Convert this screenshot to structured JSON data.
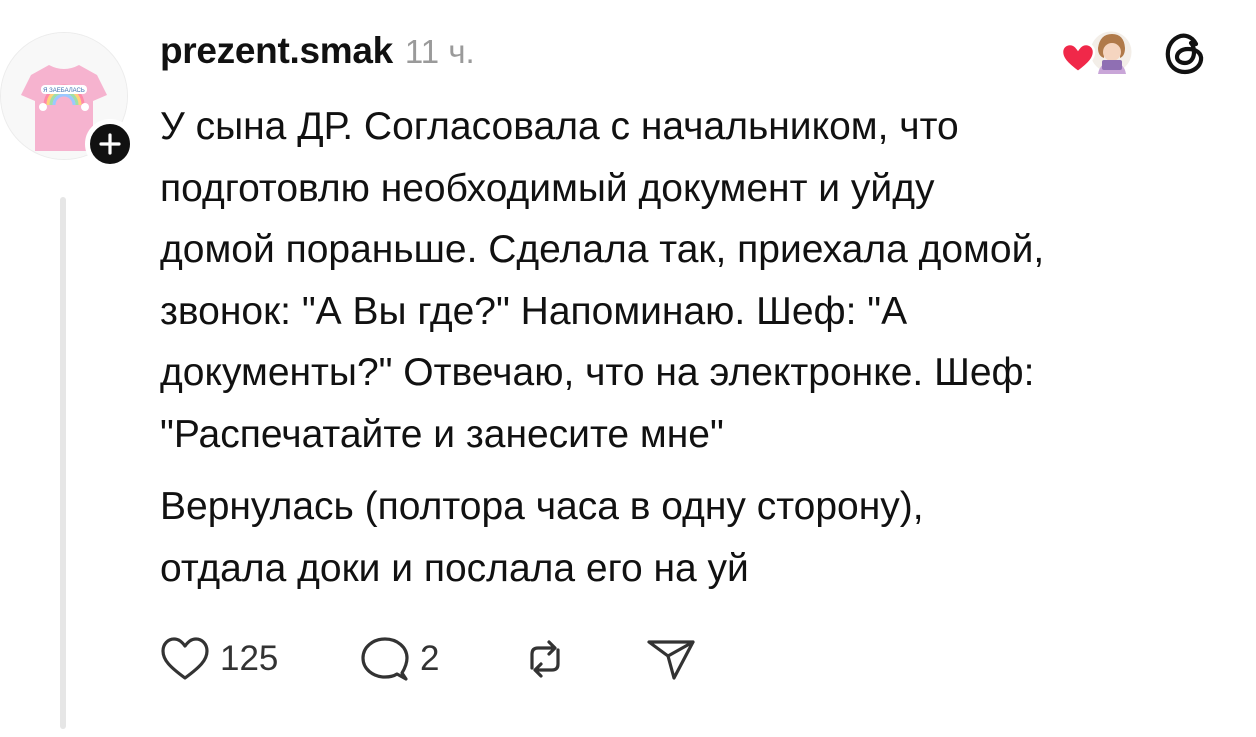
{
  "post": {
    "username": "prezent.smak",
    "timestamp": "11 ч.",
    "paragraphs": [
      "У сына ДР. Согласовала с начальником, что\nподготовлю необходимый документ и уйду\nдомой пораньше. Сделала так, приехала домой,\nзвонок: \"А Вы где?\" Напоминаю. Шеф: \"А\nдокументы?\" Отвечаю, что на электронке. Шеф:\n\"Распечатайте и занесите мне\"",
      "Вернулась (полтора часа в одну сторону),\nотдала доки и послала его на  уй"
    ],
    "avatar_shirt_text": "Я ЗАЕБАЛАСЬ"
  },
  "actions": {
    "likes": "125",
    "replies": "2"
  },
  "icons": {
    "follow": "plus-icon",
    "like": "heart-outline-icon",
    "reply": "speech-bubble-icon",
    "repost": "repost-icon",
    "share": "paper-plane-icon",
    "brand": "threads-logo-icon",
    "reaction": "red-heart-icon"
  },
  "colors": {
    "text": "#111111",
    "muted": "#9a9a9a",
    "heart_red": "#f02849",
    "shirt_pink": "#f6b3cf",
    "thread_line": "#e6e6e6"
  }
}
